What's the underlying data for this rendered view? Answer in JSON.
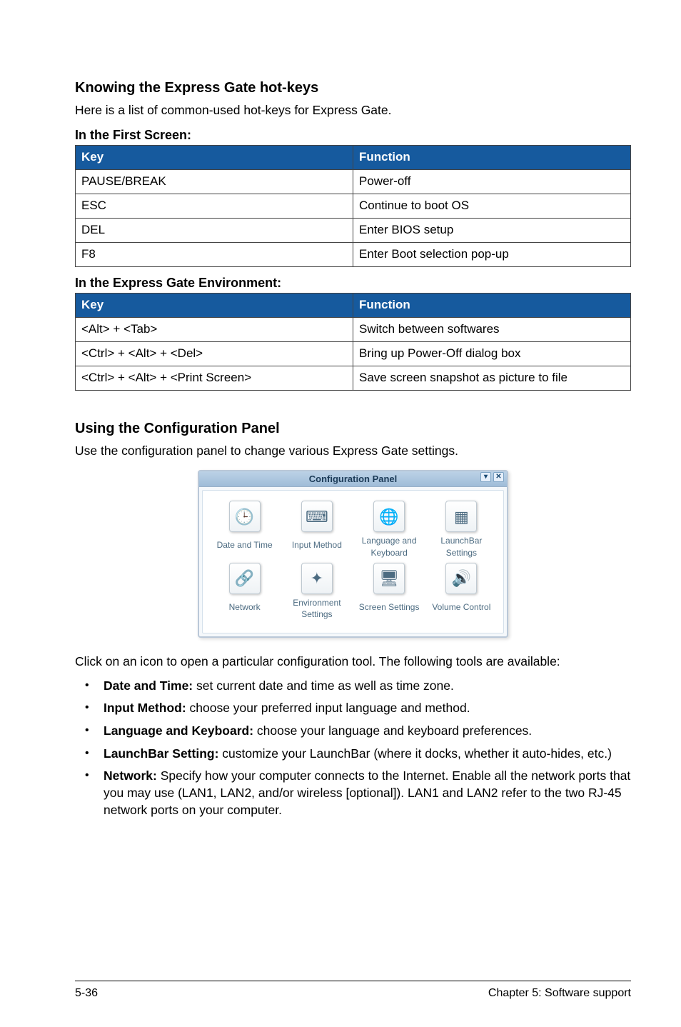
{
  "section1": {
    "heading": "Knowing the Express Gate hot-keys",
    "intro": "Here is a list of common-used hot-keys for Express Gate.",
    "sub1": "In the First Screen:",
    "table1": {
      "head_key": "Key",
      "head_fn": "Function",
      "rows": [
        {
          "k": "PAUSE/BREAK",
          "f": "Power-off"
        },
        {
          "k": "ESC",
          "f": "Continue to boot OS"
        },
        {
          "k": "DEL",
          "f": "Enter BIOS setup"
        },
        {
          "k": "F8",
          "f": "Enter Boot selection pop-up"
        }
      ]
    },
    "sub2": "In the Express Gate Environment:",
    "table2": {
      "head_key": "Key",
      "head_fn": "Function",
      "rows": [
        {
          "k": "<Alt> + <Tab>",
          "f": "Switch between softwares"
        },
        {
          "k": "<Ctrl> + <Alt> + <Del>",
          "f": "Bring up Power-Off dialog box"
        },
        {
          "k": "<Ctrl> + <Alt> + <Print Screen>",
          "f": "Save screen snapshot as picture to file"
        }
      ]
    }
  },
  "section2": {
    "heading": "Using the Configuration Panel",
    "intro": "Use the configuration panel to change various Express Gate settings.",
    "panel_title": "Configuration Panel",
    "panel_items_row1": [
      {
        "label": "Date and Time",
        "icon": "🕒"
      },
      {
        "label": "Input Method",
        "icon": "⌨"
      },
      {
        "label": "Language and Keyboard",
        "icon": "🌐"
      },
      {
        "label": "LaunchBar Settings",
        "icon": "▦"
      }
    ],
    "panel_items_row2": [
      {
        "label": "Network",
        "icon": "🔗"
      },
      {
        "label": "Environment Settings",
        "icon": "✦"
      },
      {
        "label": "Screen Settings",
        "icon": "🖥"
      },
      {
        "label": "Volume Control",
        "icon": "🔊"
      }
    ],
    "after_fig": "Click on an icon to open a particular configuration tool. The following tools are available:",
    "bullets": [
      {
        "bold": "Date and Time:",
        "rest": " set current date and time as well as time zone."
      },
      {
        "bold": "Input Method:",
        "rest": " choose your preferred input language and method."
      },
      {
        "bold": "Language and Keyboard:",
        "rest": " choose your language and keyboard preferences."
      },
      {
        "bold": "LaunchBar Setting:",
        "rest": " customize your LaunchBar (where it docks, whether it auto-hides, etc.)"
      },
      {
        "bold": "Network:",
        "rest": " Specify how your computer connects to the Internet. Enable all the network ports that you may use (LAN1, LAN2, and/or wireless [optional]). LAN1 and LAN2 refer to the two RJ-45 network ports on your computer."
      }
    ]
  },
  "footer": {
    "left": "5-36",
    "right": "Chapter 5: Software support"
  }
}
